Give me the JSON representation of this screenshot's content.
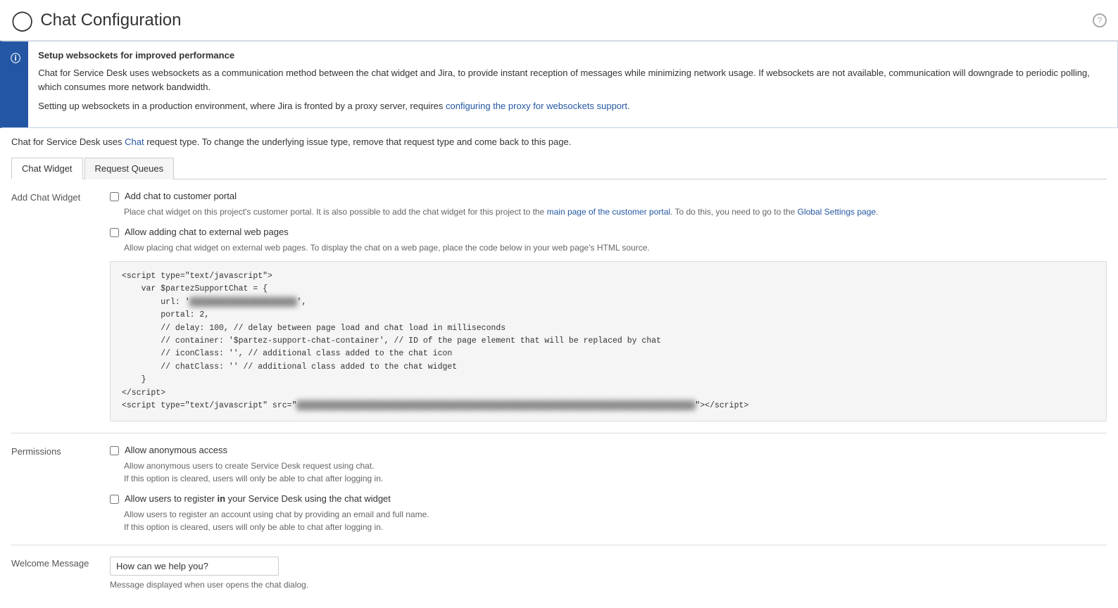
{
  "header": {
    "title": "Chat Configuration",
    "help_label": "?"
  },
  "banner": {
    "title": "Setup websockets for improved performance",
    "paragraph1": "Chat for Service Desk uses websockets as a communication method between the chat widget and Jira, to provide instant reception of messages while minimizing network usage. If websockets are not available, communication will downgrade to periodic polling, which consumes more network bandwidth.",
    "paragraph2_prefix": "Setting up websockets in a production environment, where Jira is fronted by a proxy server, requires ",
    "paragraph2_link_text": "configuring the proxy for websockets support.",
    "paragraph2_link_href": "#"
  },
  "notice": {
    "prefix": "Chat for Service Desk uses ",
    "link_text": "Chat",
    "link_href": "#",
    "suffix": " request type. To change the underlying issue type, remove that request type and come back to this page."
  },
  "tabs": [
    {
      "id": "chat-widget",
      "label": "Chat Widget",
      "active": true
    },
    {
      "id": "request-queues",
      "label": "Request Queues",
      "active": false
    }
  ],
  "add_chat_widget": {
    "section_label": "Add Chat Widget",
    "option1": {
      "label": "Add chat to customer portal",
      "checked": false,
      "help_prefix": "Place chat widget on this project's customer portal. It is also possible to add the chat widget for this project to the ",
      "help_link1_text": "main page of the customer portal",
      "help_link1_href": "#",
      "help_middle": ". To do this, you need to go to the ",
      "help_link2_text": "Global Settings page",
      "help_link2_href": "#",
      "help_suffix": "."
    },
    "option2": {
      "label": "Allow adding chat to external web pages",
      "checked": false,
      "help_text": "Allow placing chat widget on external web pages. To display the chat on a web page, place the code below in your web page's HTML source."
    },
    "code": "<script type=\"text/javascript\">\n    var $partezSupportChat = {\n        url: '                    ',\n        portal: 2,\n        // delay: 100, // delay between page load and chat load in milliseconds\n        // container: '$partez-support-chat-container', // ID of the page element that will be replaced by chat\n        // iconClass: '', // additional class added to the chat icon\n        // chatClass: '' // additional class added to the chat widget\n    }\n</script>\n<script type=\"text/javascript\" src=\"                                                                              \"></script>"
  },
  "permissions": {
    "section_label": "Permissions",
    "option1": {
      "label": "Allow anonymous access",
      "checked": false,
      "help_line1": "Allow anonymous users to create Service Desk request using chat.",
      "help_line2": "If this option is cleared, users will only be able to chat after logging in."
    },
    "option2": {
      "label_prefix": "Allow users to register ",
      "label_bold": "in",
      "label_suffix": " your Service Desk using the chat widget",
      "checked": false,
      "help_line1": "Allow users to register an account using chat by providing an email and full name.",
      "help_line2": "If this option is cleared, users will only be able to chat after logging in."
    }
  },
  "welcome_message": {
    "section_label": "Welcome Message",
    "input_value": "How can we help you?",
    "help_text": "Message displayed when user opens the chat dialog."
  }
}
